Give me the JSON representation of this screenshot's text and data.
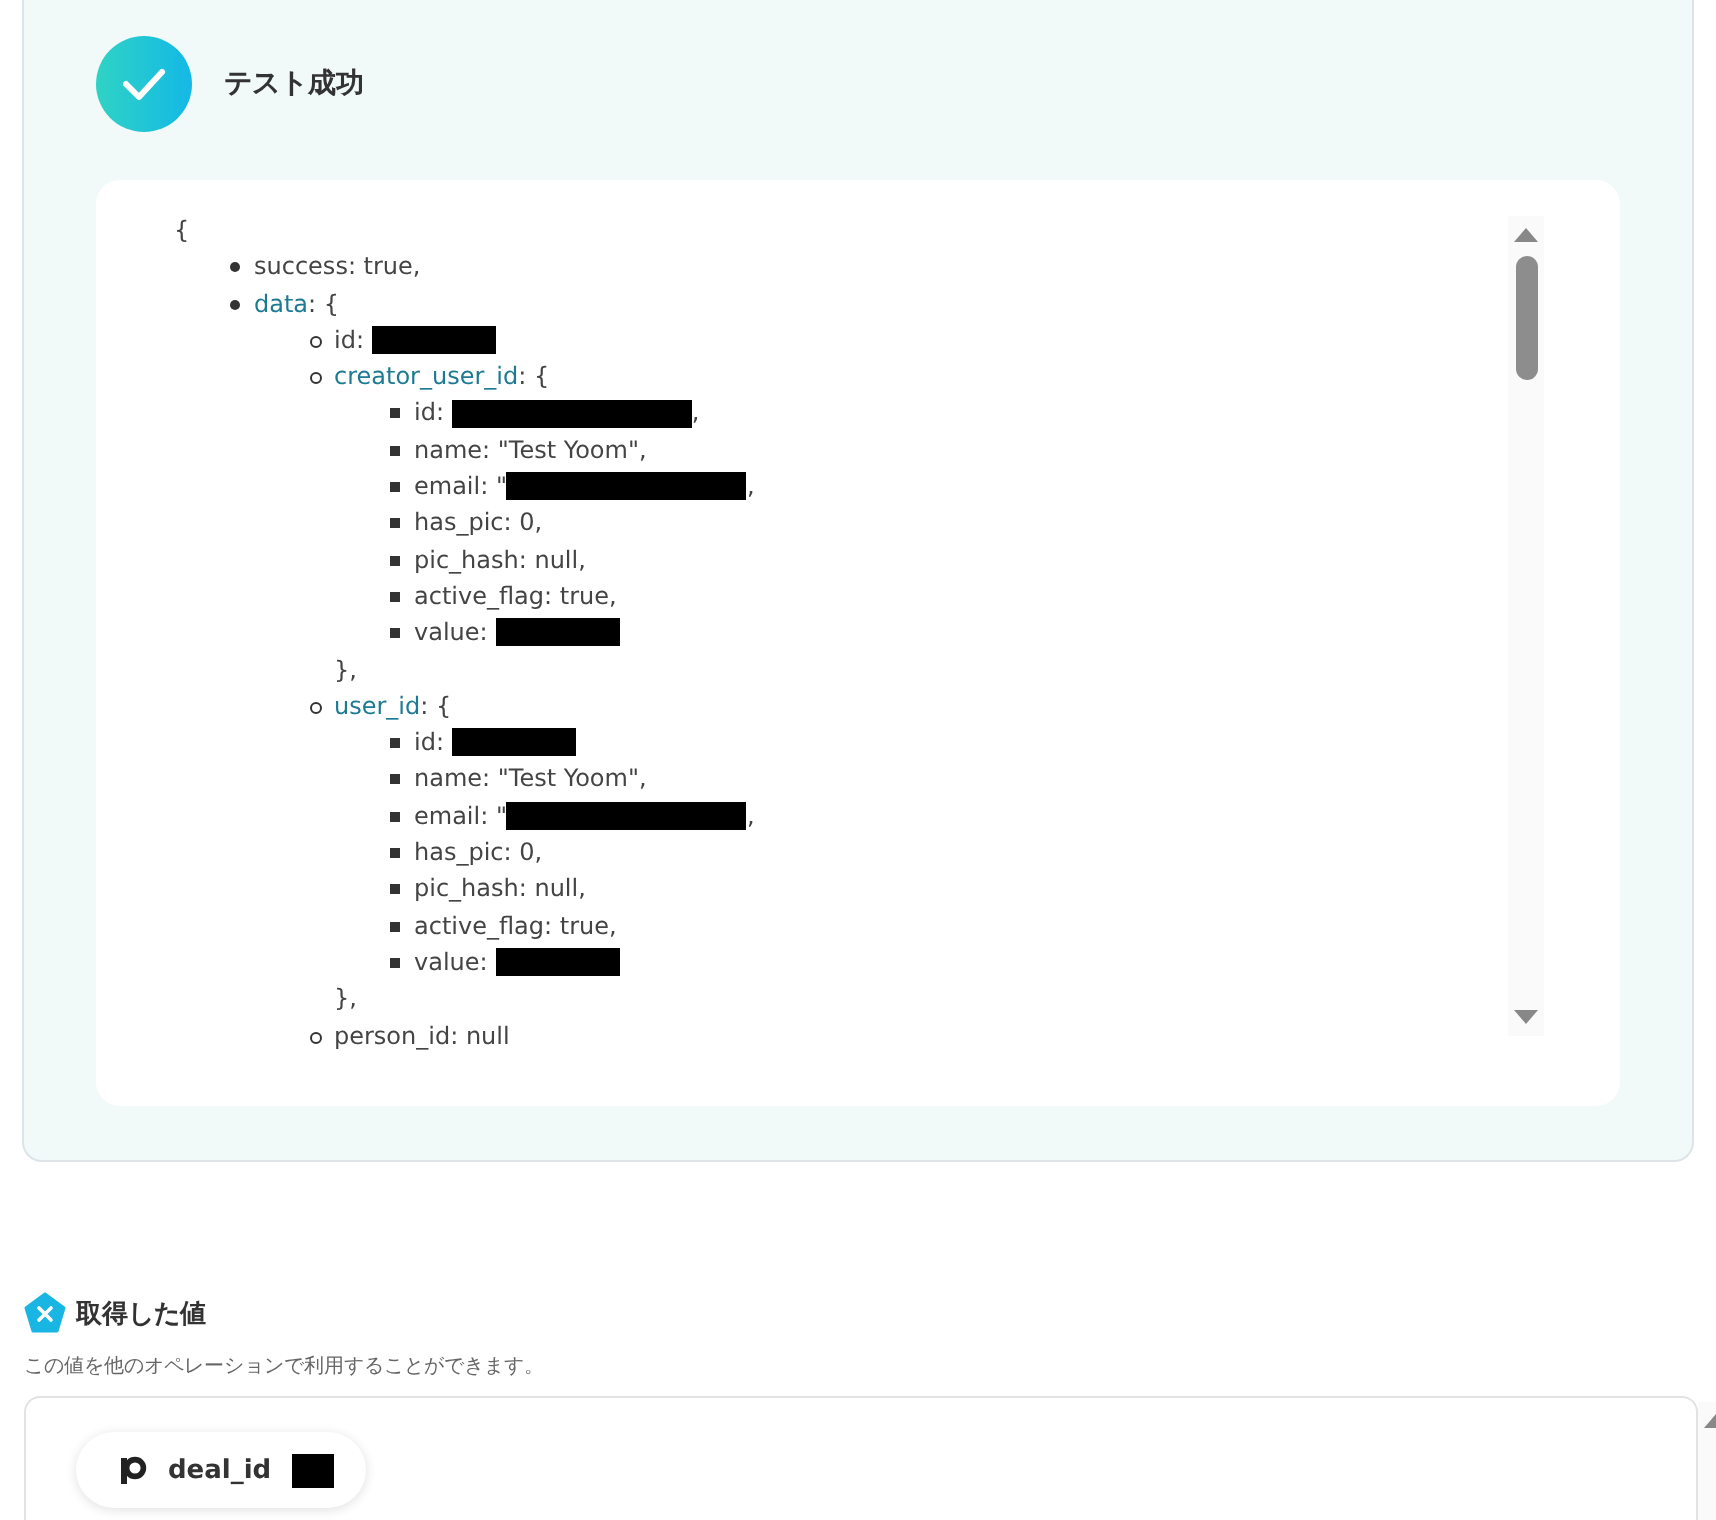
{
  "test_result": {
    "title": "テスト成功",
    "opening": "{",
    "lines": [
      {
        "kind": "entry",
        "text": "success: true,"
      },
      {
        "kind": "entry",
        "key": "data",
        "text": ": {",
        "children": [
          {
            "kind": "entry",
            "text": "id: ",
            "redacted": true
          },
          {
            "kind": "entry",
            "key": "creator_user_id",
            "text": ": {",
            "children": [
              {
                "kind": "entry",
                "text": "id: ",
                "redacted": true,
                "tail": ","
              },
              {
                "kind": "entry",
                "text": "name: \"Test Yoom\","
              },
              {
                "kind": "entry",
                "text": "email: \"",
                "redacted": true,
                "tail": ","
              },
              {
                "kind": "entry",
                "text": "has_pic: 0,"
              },
              {
                "kind": "entry",
                "text": "pic_hash: null,"
              },
              {
                "kind": "entry",
                "text": "active_flag: true,"
              },
              {
                "kind": "entry",
                "text": "value: ",
                "redacted": true
              }
            ]
          },
          {
            "kind": "close",
            "text": "},"
          },
          {
            "kind": "entry",
            "key": "user_id",
            "text": ": {",
            "children": [
              {
                "kind": "entry",
                "text": "id: ",
                "redacted": true
              },
              {
                "kind": "entry",
                "text": "name: \"Test Yoom\","
              },
              {
                "kind": "entry",
                "text": "email: \"",
                "redacted": true,
                "tail": ","
              },
              {
                "kind": "entry",
                "text": "has_pic: 0,"
              },
              {
                "kind": "entry",
                "text": "pic_hash: null,"
              },
              {
                "kind": "entry",
                "text": "active_flag: true,"
              },
              {
                "kind": "entry",
                "text": "value: ",
                "redacted": true
              }
            ]
          },
          {
            "kind": "close",
            "text": "},"
          },
          {
            "kind": "entry",
            "text": "person_id: null"
          }
        ]
      }
    ]
  },
  "obtained_values": {
    "title": "取得した値",
    "description": "この値を他のオペレーションで利用することができます。",
    "chips": [
      {
        "label": "deal_id",
        "redacted": true
      }
    ]
  }
}
